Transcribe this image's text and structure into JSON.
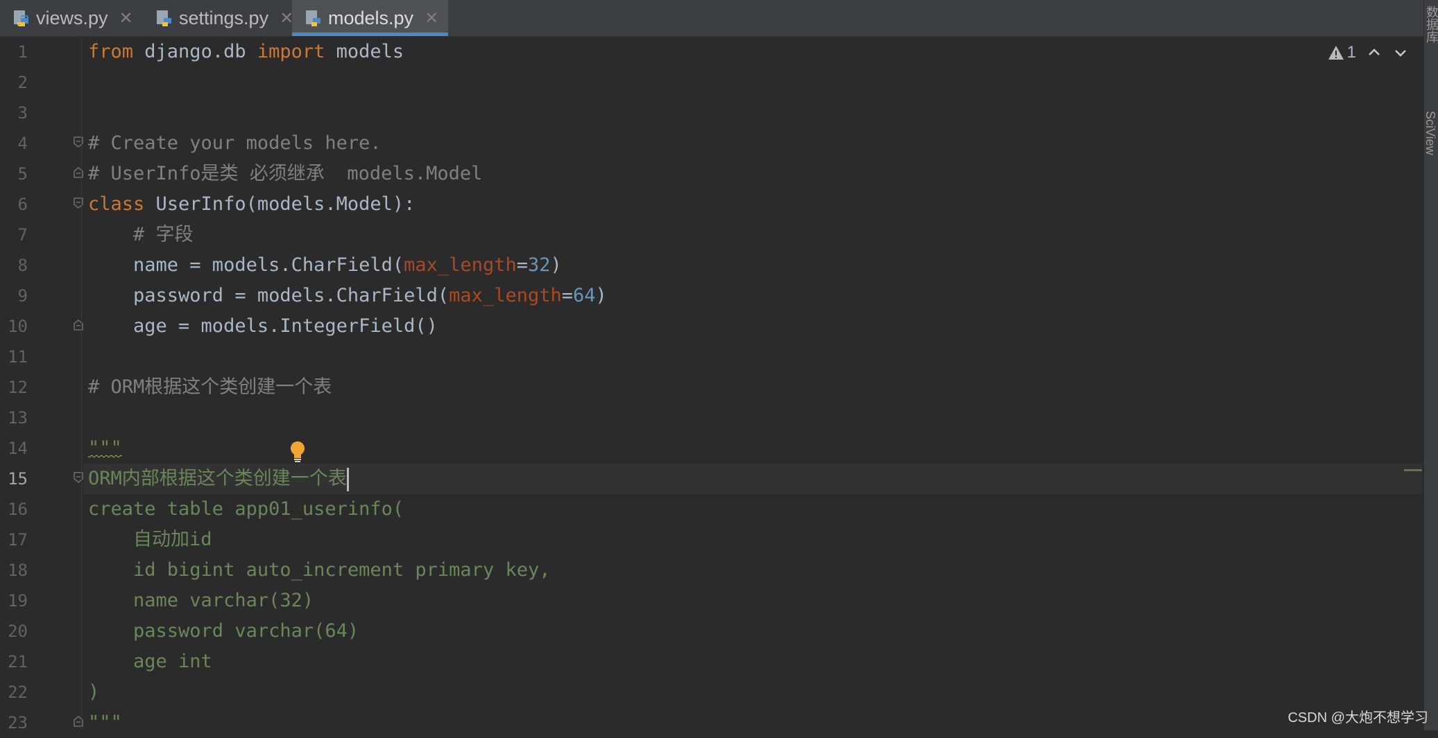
{
  "tabs": [
    {
      "label": "views.py",
      "icon": "python-file-icon",
      "active": false
    },
    {
      "label": "settings.py",
      "icon": "python-file-icon",
      "active": false
    },
    {
      "label": "models.py",
      "icon": "python-file-icon",
      "active": true
    }
  ],
  "tab_close_glyph": "✕",
  "inspection": {
    "warning_count": "1"
  },
  "right_toolbar": {
    "database_label": "数据库",
    "sciview_label": "SciView"
  },
  "line_numbers": [
    "1",
    "2",
    "3",
    "4",
    "5",
    "6",
    "7",
    "8",
    "9",
    "10",
    "11",
    "12",
    "13",
    "14",
    "15",
    "16",
    "17",
    "18",
    "19",
    "20",
    "21",
    "22",
    "23"
  ],
  "current_line": "15",
  "code": {
    "l1": {
      "kw1": "from",
      "mod": " django.db ",
      "kw2": "import",
      "rest": " models"
    },
    "l4": "# Create your models here.",
    "l5": "# UserInfo是类 必须继承  models.Model",
    "l6": {
      "kw": "class",
      "rest": " UserInfo(models.Model):"
    },
    "l7": "    # 字段",
    "l8": {
      "pre": "    name = models.CharField(",
      "param": "max_length",
      "eq": "=",
      "num": "32",
      "post": ")"
    },
    "l9": {
      "pre": "    password = models.CharField(",
      "param": "max_length",
      "eq": "=",
      "num": "64",
      "post": ")"
    },
    "l10": "    age = models.IntegerField()",
    "l12": "# ORM根据这个类创建一个表",
    "l14": "\"\"\"",
    "l15": "ORM内部根据这个类创建一个表",
    "l16": "create table app01_userinfo(",
    "l17": "    自动加id",
    "l18": "    id bigint auto_increment primary key,",
    "l19": "    name varchar(32)",
    "l20": "    password varchar(64)",
    "l21": "    age int",
    "l22": ")",
    "l23": "\"\"\""
  },
  "colors": {
    "keyword": "#cc7832",
    "comment": "#808080",
    "number": "#6897bb",
    "param": "#aa4926",
    "string": "#6a8759",
    "accent": "#4a88c7"
  },
  "watermark": "CSDN @大炮不想学习"
}
